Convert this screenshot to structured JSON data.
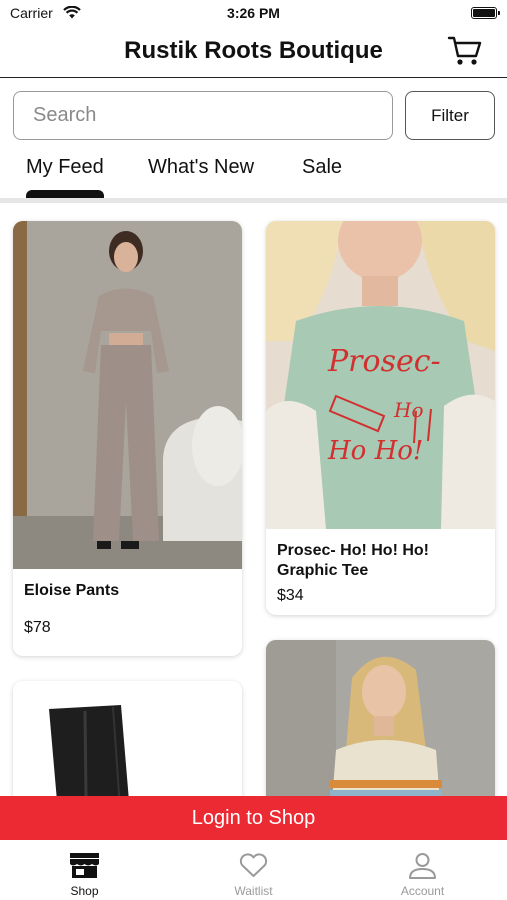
{
  "status_bar": {
    "carrier": "Carrier",
    "time": "3:26 PM"
  },
  "header": {
    "title": "Rustik Roots Boutique"
  },
  "search": {
    "placeholder": "Search"
  },
  "filter": {
    "label": "Filter"
  },
  "tabs": [
    {
      "label": "My Feed",
      "active": true
    },
    {
      "label": "What's New",
      "active": false
    },
    {
      "label": "Sale",
      "active": false
    }
  ],
  "products": [
    {
      "name": "Eloise Pants",
      "price": "$78"
    },
    {
      "name": "Prosec- Ho! Ho! Ho! Graphic Tee",
      "price": "$34"
    }
  ],
  "graphic_tee_print": {
    "line1": "Prosec-",
    "line2": "Ho",
    "line3": "Ho Ho!"
  },
  "login_banner": {
    "label": "Login to Shop"
  },
  "bottom_nav": [
    {
      "label": "Shop",
      "icon": "storefront-icon",
      "active": true
    },
    {
      "label": "Waitlist",
      "icon": "heart-icon",
      "active": false
    },
    {
      "label": "Account",
      "icon": "person-icon",
      "active": false
    }
  ],
  "colors": {
    "accent": "#ec2a33",
    "active_nav": "#111111",
    "inactive_nav": "#9a9a9a",
    "tee": "#a8c9b4",
    "tee_print": "#d22f2f"
  }
}
